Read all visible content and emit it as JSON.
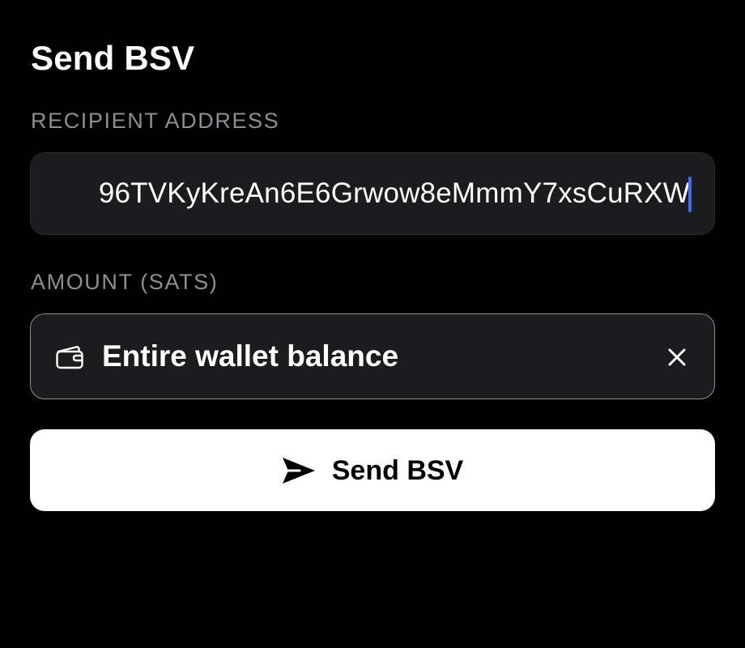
{
  "header": {
    "title": "Send BSV"
  },
  "recipient": {
    "label": "RECIPIENT ADDRESS",
    "value": "96TVKyKreAn6E6Grwow8eMmmY7xsCuRXW"
  },
  "amount": {
    "label": "AMOUNT (SATS)",
    "value": "Entire wallet balance",
    "icon": "wallet-icon",
    "clear_icon": "close-icon"
  },
  "send_button": {
    "label": "Send BSV",
    "icon": "send-icon"
  },
  "colors": {
    "background": "#000000",
    "field_background": "#1c1c1e",
    "label": "#8e8e93",
    "caret": "#3d6df2",
    "button_background": "#ffffff",
    "button_text": "#000000"
  }
}
